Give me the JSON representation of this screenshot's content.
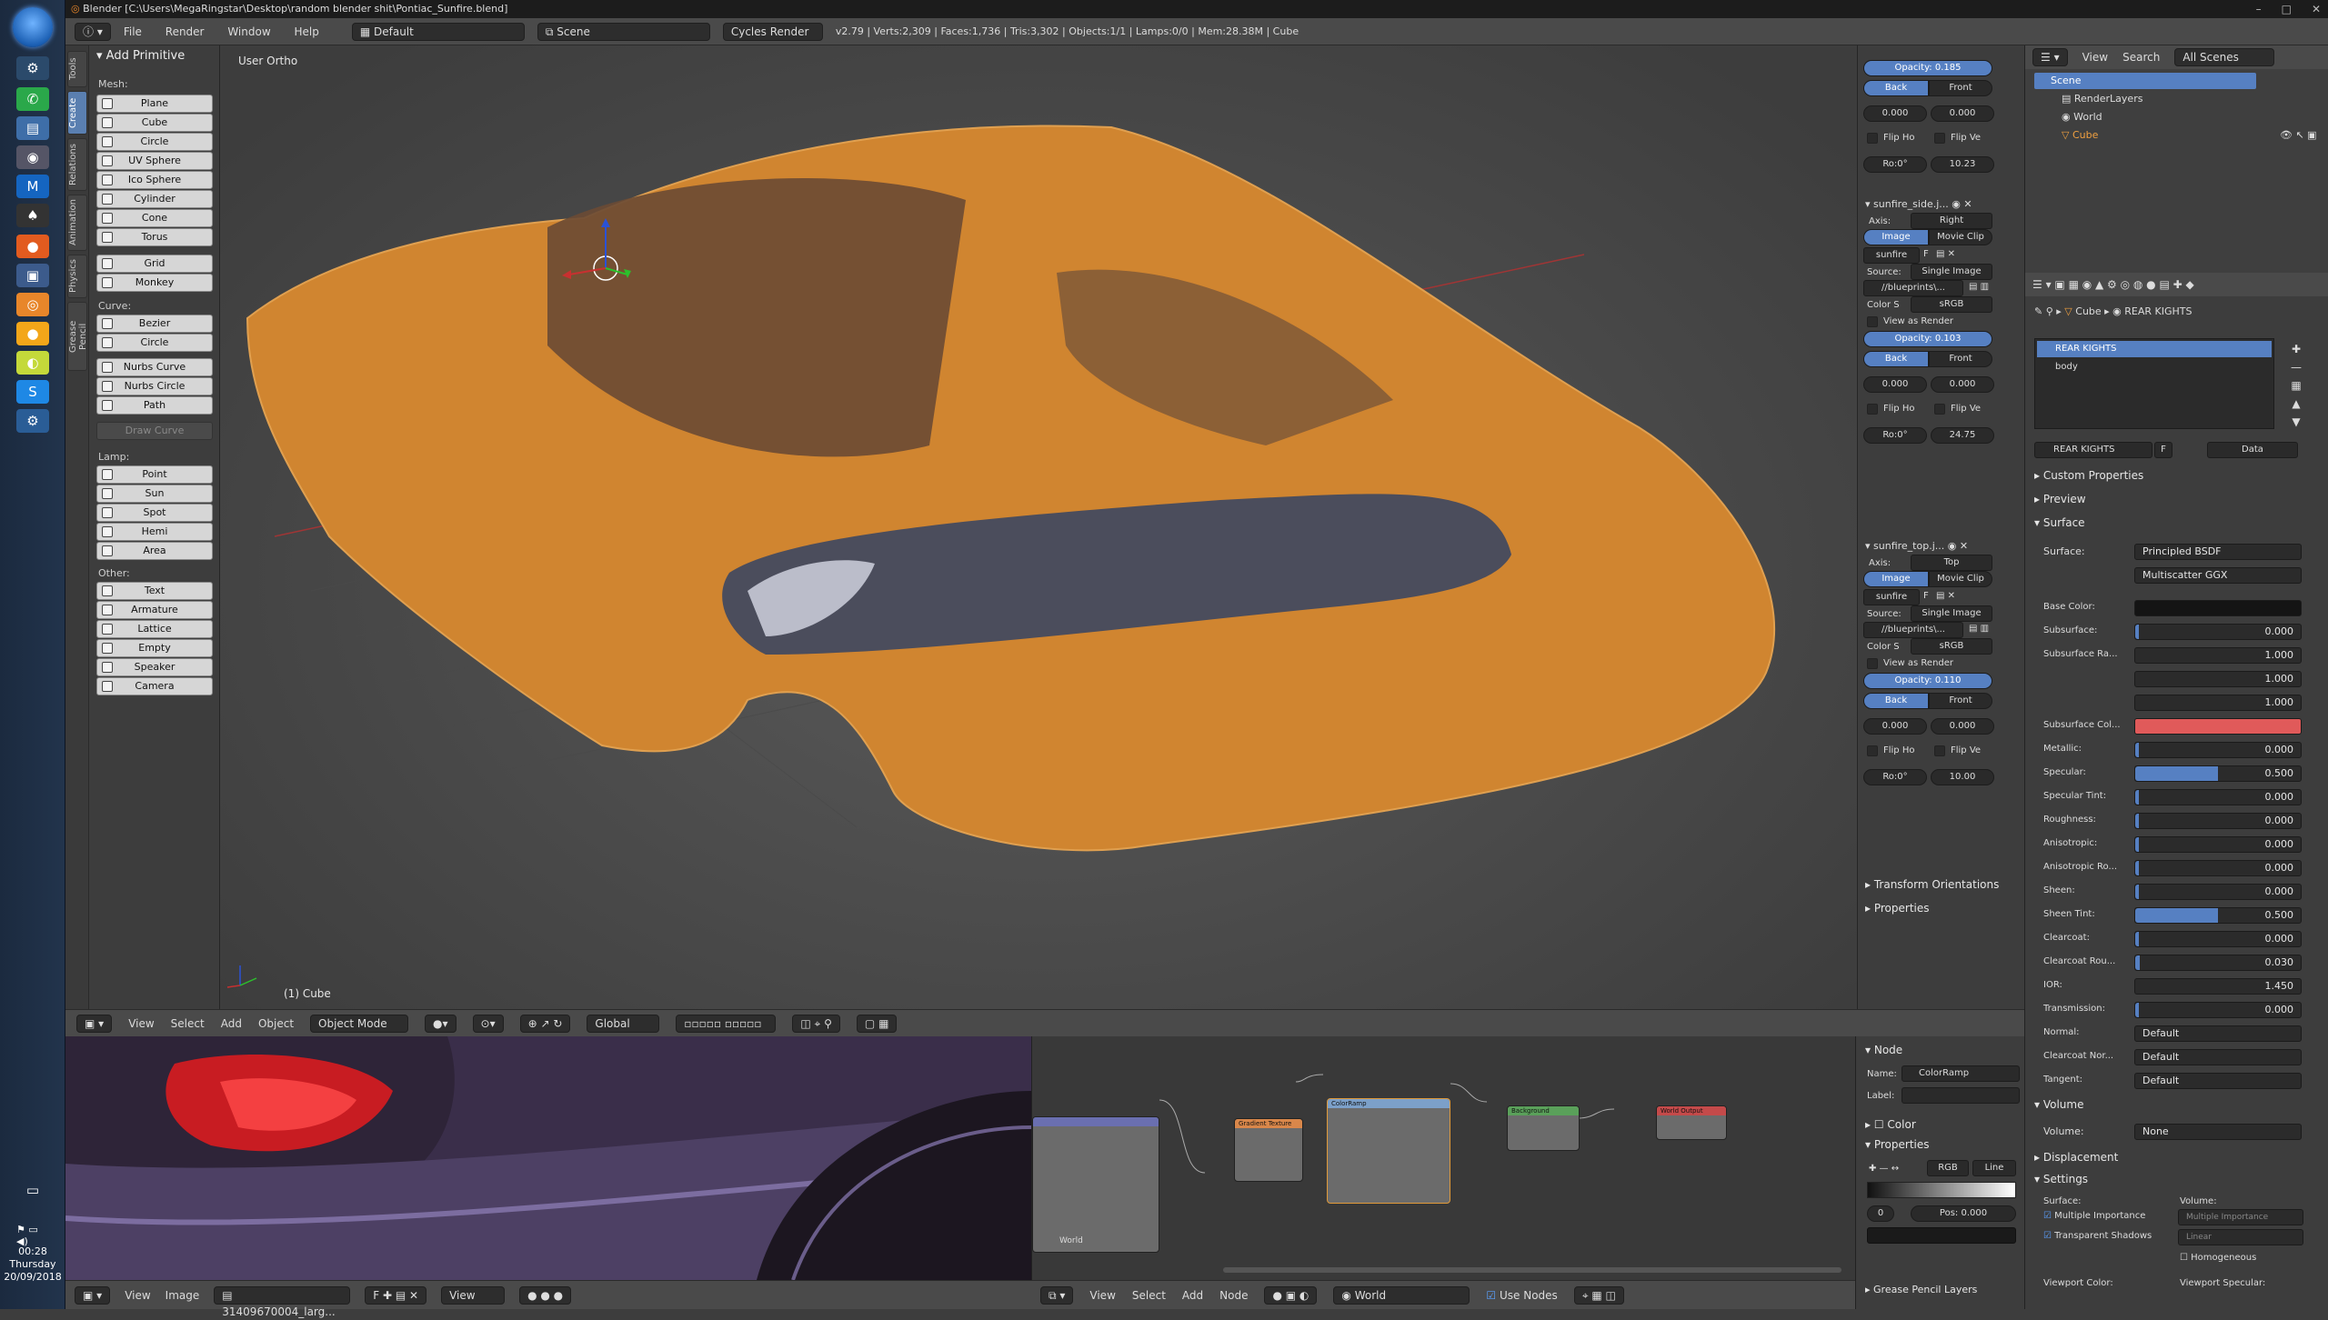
{
  "window": {
    "title": "Blender [C:\\Users\\MegaRingstar\\Desktop\\random blender shit\\Pontiac_Sunfire.blend]",
    "controls": [
      "–",
      "□",
      "✕"
    ]
  },
  "taskbar": {
    "time": "00:28",
    "day": "Thursday",
    "date": "20/09/2018"
  },
  "info_header": {
    "menus": [
      "File",
      "Render",
      "Window",
      "Help"
    ],
    "layout": "Default",
    "scene": "Scene",
    "engine": "Cycles Render",
    "stats": "v2.79 | Verts:2,309 | Faces:1,736 | Tris:3,302 | Objects:1/1 | Lamps:0/0 | Mem:28.38M | Cube"
  },
  "tool_tabs": [
    "Tools",
    "Create",
    "Relations",
    "Animation",
    "Physics",
    "Grease Pencil"
  ],
  "tool_shelf": {
    "header": "Add Primitive",
    "mesh_label": "Mesh:",
    "mesh": [
      "Plane",
      "Cube",
      "Circle",
      "UV Sphere",
      "Ico Sphere",
      "Cylinder",
      "Cone",
      "Torus"
    ],
    "mesh2": [
      "Grid",
      "Monkey"
    ],
    "curve_label": "Curve:",
    "curve": [
      "Bezier",
      "Circle"
    ],
    "curve2": [
      "Nurbs Curve",
      "Nurbs Circle",
      "Path"
    ],
    "draw_curve": "Draw Curve",
    "lamp_label": "Lamp:",
    "lamp": [
      "Point",
      "Sun",
      "Spot",
      "Hemi",
      "Area"
    ],
    "other_label": "Other:",
    "other": [
      "Text",
      "Armature",
      "Lattice",
      "Empty",
      "Speaker",
      "Camera"
    ]
  },
  "viewport": {
    "label": "User Ortho",
    "object": "(1) Cube",
    "car_color": "#d3862f"
  },
  "viewport_header": {
    "view": "View",
    "select": "Select",
    "add": "Add",
    "object": "Object",
    "mode": "Object Mode",
    "orientation": "Global"
  },
  "bg_images": {
    "top_opacity_label": "Opacity:",
    "top_opacity": "0.185",
    "back": "Back",
    "front": "Front",
    "offx": "0.000",
    "offy": "0.000",
    "fliph": "Flip Ho",
    "flipv": "Flip Ve",
    "rot": "Ro:0°",
    "scale": "10.23",
    "img2": {
      "name": "sunfire_side.j...",
      "axis_label": "Axis:",
      "axis": "Right",
      "image": "Image",
      "movie": "Movie Clip",
      "file": "sunfire",
      "f": "F",
      "source_label": "Source:",
      "source": "Single Image",
      "path": "//blueprints\\...",
      "color_label": "Color S",
      "color": "sRGB",
      "view_render": "View as Render",
      "opacity_label": "Opacity:",
      "opacity": "0.103",
      "offx": "0.000",
      "offy": "0.000",
      "rot": "Ro:0°",
      "scale": "24.75"
    },
    "img3": {
      "name": "sunfire_top.j...",
      "axis_label": "Axis:",
      "axis": "Top",
      "image": "Image",
      "movie": "Movie Clip",
      "file": "sunfire",
      "f": "F",
      "source_label": "Source:",
      "source": "Single Image",
      "path": "//blueprints\\...",
      "color_label": "Color S",
      "color": "sRGB",
      "view_render": "View as Render",
      "opacity_label": "Opacity:",
      "opacity": "0.110",
      "offx": "0.000",
      "offy": "0.000",
      "rot": "Ro:0°",
      "scale": "10.00"
    },
    "transform_orient": "Transform Orientations",
    "properties": "Properties"
  },
  "outliner": {
    "view": "View",
    "search": "Search",
    "filter": "All Scenes",
    "items": [
      "Scene",
      "RenderLayers",
      "World",
      "Cube"
    ]
  },
  "properties": {
    "breadcrumb": [
      "Cube",
      "REAR KIGHTS"
    ],
    "materials": [
      "REAR KIGHTS",
      "body"
    ],
    "mat_field": "REAR KIGHTS",
    "mat_f": "F",
    "mat_data": "Data",
    "custom": "Custom Properties",
    "preview": "Preview",
    "surface_hd": "Surface",
    "surface_label": "Surface:",
    "surface": "Principled BSDF",
    "distribution": "Multiscatter GGX",
    "rows": [
      {
        "label": "Base Color:",
        "value": "",
        "fill": 0,
        "type": "color",
        "color": "#141414"
      },
      {
        "label": "Subsurface:",
        "value": "0.000",
        "fill": 0.02,
        "type": "num"
      },
      {
        "label": "Subsurface Ra...",
        "value": "1.000",
        "fill": 0,
        "type": "num"
      },
      {
        "label": "",
        "value": "1.000",
        "fill": 0,
        "type": "num"
      },
      {
        "label": "",
        "value": "1.000",
        "fill": 0,
        "type": "num"
      },
      {
        "label": "Subsurface Col...",
        "value": "",
        "fill": 0,
        "type": "color",
        "color": "#e05a5a"
      },
      {
        "label": "Metallic:",
        "value": "0.000",
        "fill": 0.02,
        "type": "num"
      },
      {
        "label": "Specular:",
        "value": "0.500",
        "fill": 0.5,
        "type": "num"
      },
      {
        "label": "Specular Tint:",
        "value": "0.000",
        "fill": 0.02,
        "type": "num"
      },
      {
        "label": "Roughness:",
        "value": "0.000",
        "fill": 0.02,
        "type": "num"
      },
      {
        "label": "Anisotropic:",
        "value": "0.000",
        "fill": 0.02,
        "type": "num"
      },
      {
        "label": "Anisotropic Ro...",
        "value": "0.000",
        "fill": 0.02,
        "type": "num"
      },
      {
        "label": "Sheen:",
        "value": "0.000",
        "fill": 0.02,
        "type": "num"
      },
      {
        "label": "Sheen Tint:",
        "value": "0.500",
        "fill": 0.5,
        "type": "num"
      },
      {
        "label": "Clearcoat:",
        "value": "0.000",
        "fill": 0.02,
        "type": "num"
      },
      {
        "label": "Clearcoat Rou...",
        "value": "0.030",
        "fill": 0.03,
        "type": "num"
      },
      {
        "label": "IOR:",
        "value": "1.450",
        "fill": 0,
        "type": "num"
      },
      {
        "label": "Transmission:",
        "value": "0.000",
        "fill": 0.02,
        "type": "num"
      },
      {
        "label": "Normal:",
        "value": "Default",
        "fill": 0,
        "type": "menu"
      },
      {
        "label": "Clearcoat Nor...",
        "value": "Default",
        "fill": 0,
        "type": "menu"
      },
      {
        "label": "Tangent:",
        "value": "Default",
        "fill": 0,
        "type": "menu"
      }
    ],
    "volume_hd": "Volume",
    "volume_label": "Volume:",
    "volume": "None",
    "displacement": "Displacement",
    "settings": "Settings",
    "set_surface": "Surface:",
    "set_volume": "Volume:",
    "multi_imp": "Multiple Importance",
    "multi_imp2": "Multiple Importance",
    "transp": "Transparent Shadows",
    "linear": "Linear",
    "homog": "Homogeneous",
    "viewport_color": "Viewport Color:",
    "viewport_spec": "Viewport Specular:"
  },
  "node_props": {
    "node_hd": "Node",
    "name_label": "Name:",
    "name": "ColorRamp",
    "label_label": "Label:",
    "color": "Color",
    "properties": "Properties",
    "rgb": "RGB",
    "interp": "Line",
    "index": "0",
    "pos": "Pos: 0.000",
    "grease": "Grease Pencil Layers"
  },
  "node_editor": {
    "menus": [
      "View",
      "Select",
      "Add",
      "Node"
    ],
    "world": "World",
    "use_nodes": "Use Nodes",
    "nodes": [
      "",
      "Gradient Texture",
      "ColorRamp",
      "Background",
      "World Output"
    ],
    "frame_label": "World"
  },
  "image_editor": {
    "menus": [
      "View",
      "Image"
    ],
    "image": "31409670004_larg...",
    "view": "View"
  }
}
